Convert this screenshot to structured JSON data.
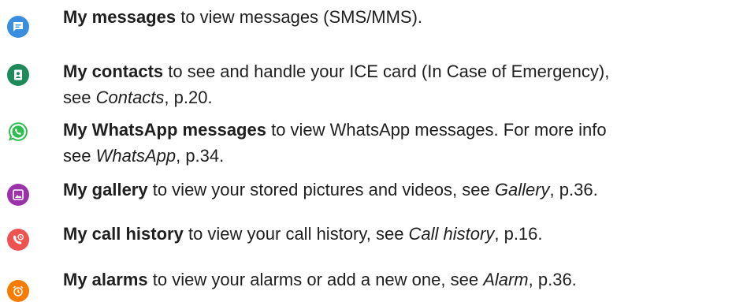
{
  "colors": {
    "messages_icon": "#3a8ee0",
    "contacts_icon": "#1e8a5a",
    "whatsapp_icon": "#2ebd4f",
    "gallery_icon": "#9b33a8",
    "calls_icon": "#ef5350",
    "alarms_icon": "#f57c00"
  },
  "items": [
    {
      "icon": "messages-icon",
      "title": "My messages",
      "text": " to view messages (SMS/MMS)."
    },
    {
      "icon": "contacts-icon",
      "title": "My contacts",
      "text": " to see and handle your ICE card (In Case of Emergency),",
      "line2_prefix": "see ",
      "ref": "Contacts",
      "suffix": ", p.20."
    },
    {
      "icon": "whatsapp-icon",
      "title": "My WhatsApp messages",
      "text": " to view WhatsApp messages. For more info",
      "line2_prefix": "see ",
      "ref": "WhatsApp",
      "suffix": ", p.34."
    },
    {
      "icon": "gallery-icon",
      "title": "My gallery",
      "text": " to view your stored pictures and videos, see ",
      "ref": "Gallery",
      "suffix": ", p.36."
    },
    {
      "icon": "call-history-icon",
      "title": "My call history",
      "text": " to view your call history, see ",
      "ref": "Call history",
      "suffix": ", p.16."
    },
    {
      "icon": "alarm-icon",
      "title": "My alarms",
      "text": " to view your alarms or add a new one, see ",
      "ref": "Alarm",
      "suffix": ", p.36."
    }
  ]
}
